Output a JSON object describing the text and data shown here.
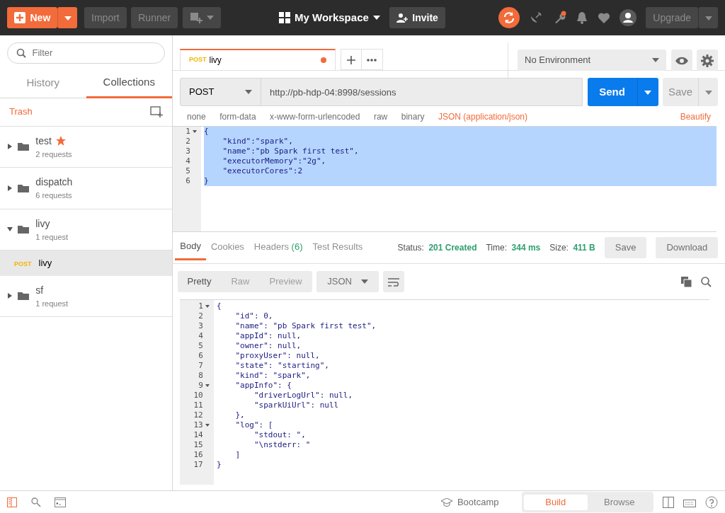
{
  "header": {
    "new_label": "New",
    "import_label": "Import",
    "runner_label": "Runner",
    "workspace": "My Workspace",
    "invite_label": "Invite",
    "upgrade_label": "Upgrade",
    "notification_dot": true
  },
  "sidebar": {
    "filter_placeholder": "Filter",
    "tabs": [
      {
        "label": "History",
        "selected": false
      },
      {
        "label": "Collections",
        "selected": true
      }
    ],
    "trash_label": "Trash",
    "collections": [
      {
        "name": "test",
        "starred": true,
        "count": "2 requests",
        "expanded": false
      },
      {
        "name": "dispatch",
        "starred": false,
        "count": "6 requests",
        "expanded": false
      },
      {
        "name": "livy",
        "starred": false,
        "count": "1 request",
        "expanded": true,
        "children": [
          {
            "method": "POST",
            "name": "livy",
            "selected": true
          }
        ]
      },
      {
        "name": "sf",
        "starred": false,
        "count": "1 request",
        "expanded": false
      }
    ]
  },
  "request_tabs": [
    {
      "method": "POST",
      "name": "livy",
      "unsaved": true,
      "selected": true
    }
  ],
  "environment": "No Environment",
  "request": {
    "method": "POST",
    "url": "http://pb-hdp-04:8998/sessions",
    "send_label": "Send",
    "save_label": "Save",
    "body_types": [
      {
        "label": "none",
        "kind": "radio"
      },
      {
        "label": "form-data",
        "kind": "radio"
      },
      {
        "label": "x-www-form-urlencoded",
        "kind": "radio"
      },
      {
        "label": "raw",
        "kind": "radio"
      },
      {
        "label": "binary",
        "kind": "radio"
      },
      {
        "label": "JSON (application/json)",
        "kind": "link"
      }
    ],
    "beautify_label": "Beautify",
    "body_lines": [
      {
        "num": "1",
        "text": "{",
        "fold": true,
        "selected": true
      },
      {
        "num": "2",
        "text": "    \"kind\":\"spark\",",
        "fold": false,
        "selected": true
      },
      {
        "num": "3",
        "text": "    \"name\":\"pb Spark first test\",",
        "fold": false,
        "selected": true
      },
      {
        "num": "4",
        "text": "    \"executorMemory\":\"2g\",",
        "fold": false,
        "selected": true
      },
      {
        "num": "5",
        "text": "    \"executorCores\":2",
        "fold": false,
        "selected": true
      },
      {
        "num": "6",
        "text": "}",
        "fold": false,
        "selected": true
      }
    ]
  },
  "response": {
    "tabs": [
      {
        "label": "Body",
        "selected": true
      },
      {
        "label": "Cookies",
        "selected": false
      },
      {
        "label": "Headers",
        "selected": false,
        "count": "(6)"
      },
      {
        "label": "Test Results",
        "selected": false
      }
    ],
    "status_label": "Status:",
    "status": "201 Created",
    "time_label": "Time:",
    "time": "344 ms",
    "size_label": "Size:",
    "size": "411 B",
    "save_label": "Save",
    "download_label": "Download",
    "views": [
      {
        "label": "Pretty",
        "selected": true
      },
      {
        "label": "Raw",
        "selected": false
      },
      {
        "label": "Preview",
        "selected": false
      }
    ],
    "format": "JSON",
    "lines": [
      {
        "num": "1",
        "text": "{",
        "fold": true
      },
      {
        "num": "2",
        "text": "    \"id\": 0,",
        "fold": false
      },
      {
        "num": "3",
        "text": "    \"name\": \"pb Spark first test\",",
        "fold": false
      },
      {
        "num": "4",
        "text": "    \"appId\": null,",
        "fold": false
      },
      {
        "num": "5",
        "text": "    \"owner\": null,",
        "fold": false
      },
      {
        "num": "6",
        "text": "    \"proxyUser\": null,",
        "fold": false
      },
      {
        "num": "7",
        "text": "    \"state\": \"starting\",",
        "fold": false
      },
      {
        "num": "8",
        "text": "    \"kind\": \"spark\",",
        "fold": false
      },
      {
        "num": "9",
        "text": "    \"appInfo\": {",
        "fold": true
      },
      {
        "num": "10",
        "text": "        \"driverLogUrl\": null,",
        "fold": false
      },
      {
        "num": "11",
        "text": "        \"sparkUiUrl\": null",
        "fold": false
      },
      {
        "num": "12",
        "text": "    },",
        "fold": false
      },
      {
        "num": "13",
        "text": "    \"log\": [",
        "fold": true
      },
      {
        "num": "14",
        "text": "        \"stdout: \",",
        "fold": false
      },
      {
        "num": "15",
        "text": "        \"\\nstderr: \"",
        "fold": false
      },
      {
        "num": "16",
        "text": "    ]",
        "fold": false
      },
      {
        "num": "17",
        "text": "}",
        "fold": false
      }
    ]
  },
  "footer": {
    "bootcamp_label": "Bootcamp",
    "modes": [
      {
        "label": "Build",
        "selected": true
      },
      {
        "label": "Browse",
        "selected": false
      }
    ]
  }
}
